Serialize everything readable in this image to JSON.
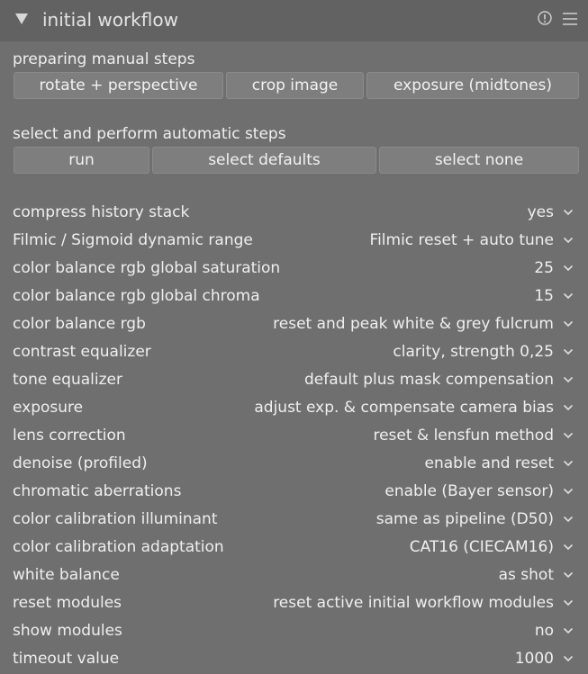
{
  "header": {
    "title": "initial workflow",
    "icons": {
      "collapse": "triangle-down-icon",
      "reset": "reset-icon",
      "presets": "hamburger-menu-icon"
    }
  },
  "manual": {
    "label": "preparing manual steps",
    "buttons": [
      "rotate + perspective",
      "crop image",
      "exposure (midtones)"
    ]
  },
  "automatic": {
    "label": "select and perform automatic steps",
    "buttons": [
      "run",
      "select defaults",
      "select none"
    ]
  },
  "settings": [
    {
      "label": "compress history stack",
      "value": "yes"
    },
    {
      "label": "Filmic / Sigmoid dynamic range",
      "value": "Filmic reset + auto tune"
    },
    {
      "label": "color balance rgb global saturation",
      "value": "25"
    },
    {
      "label": "color balance rgb global chroma",
      "value": "15"
    },
    {
      "label": "color balance rgb",
      "value": "reset and peak white & grey fulcrum"
    },
    {
      "label": "contrast equalizer",
      "value": "clarity, strength 0,25"
    },
    {
      "label": "tone equalizer",
      "value": "default plus mask compensation"
    },
    {
      "label": "exposure",
      "value": "adjust exp. & compensate camera bias"
    },
    {
      "label": "lens correction",
      "value": "reset & lensfun method"
    },
    {
      "label": "denoise (profiled)",
      "value": "enable and reset"
    },
    {
      "label": "chromatic aberrations",
      "value": "enable (Bayer sensor)"
    },
    {
      "label": "color calibration illuminant",
      "value": "same as pipeline (D50)"
    },
    {
      "label": "color calibration adaptation",
      "value": "CAT16 (CIECAM16)"
    },
    {
      "label": "white balance",
      "value": "as shot"
    },
    {
      "label": "reset modules",
      "value": "reset active initial workflow modules"
    },
    {
      "label": "show modules",
      "value": "no"
    },
    {
      "label": "timeout value",
      "value": "1000"
    }
  ],
  "colors": {
    "panel_bg": "#6f6f6f",
    "header_bg": "#626262",
    "button_bg": "#7e7e7e",
    "text": "#efefef"
  }
}
